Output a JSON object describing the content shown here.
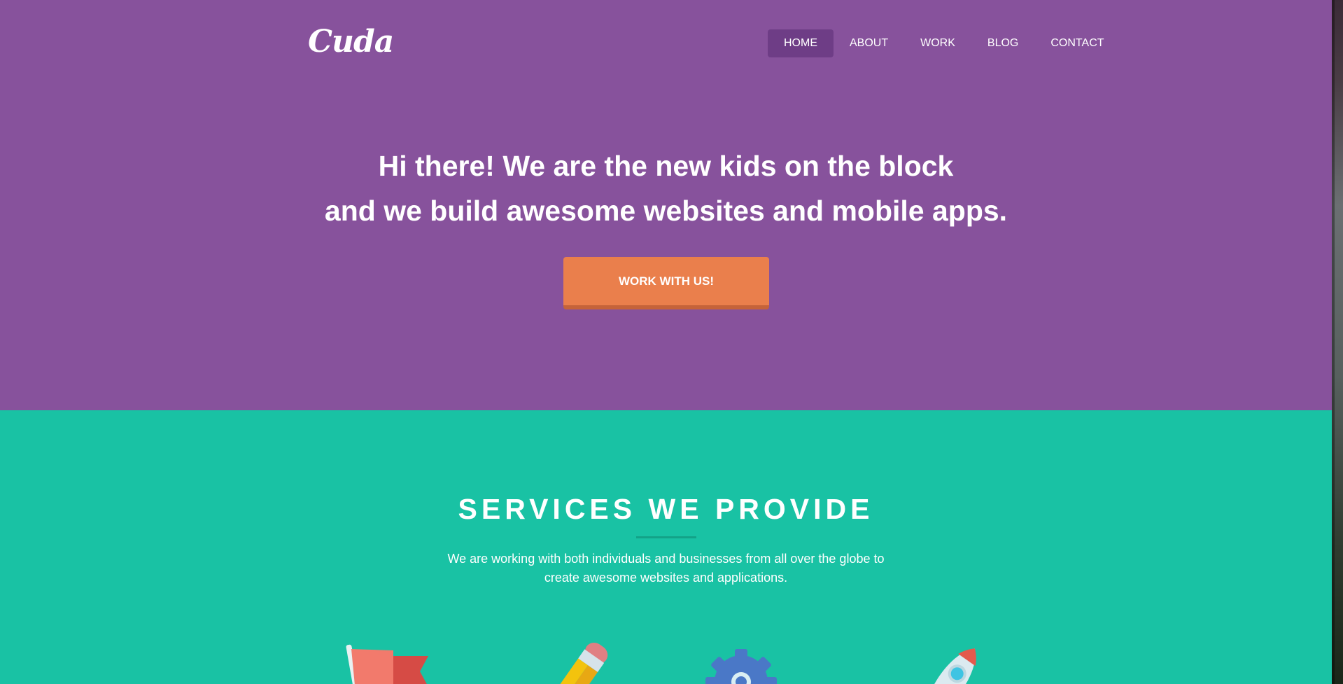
{
  "header": {
    "logo": "Cuda",
    "nav": [
      {
        "label": "HOME",
        "active": true
      },
      {
        "label": "ABOUT",
        "active": false
      },
      {
        "label": "WORK",
        "active": false
      },
      {
        "label": "BLOG",
        "active": false
      },
      {
        "label": "CONTACT",
        "active": false
      }
    ]
  },
  "hero": {
    "line1": "Hi there! We are the new kids on the block",
    "line2": "and we build awesome websites and mobile apps.",
    "cta_label": "WORK WITH US!"
  },
  "services": {
    "title": "SERVICES WE PROVIDE",
    "desc_line1": "We are working with both individuals and businesses from all over the globe to",
    "desc_line2": "create awesome websites and applications.",
    "icons": [
      "flag-icon",
      "pencil-icon",
      "gear-icon",
      "rocket-icon"
    ]
  },
  "colors": {
    "hero_bg": "#87529c",
    "nav_active_bg": "#6e3d86",
    "cta_bg": "#ea7f4c",
    "services_bg": "#19c2a4"
  }
}
